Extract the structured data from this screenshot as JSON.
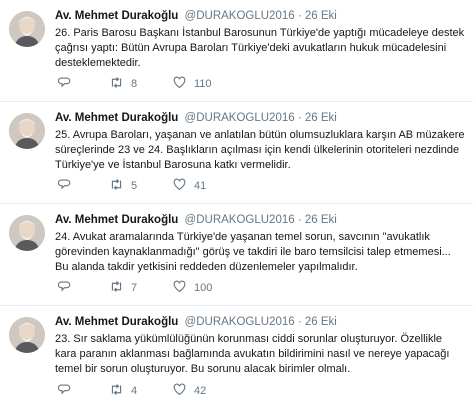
{
  "tweets": [
    {
      "name": "Av. Mehmet Durakoğlu",
      "handle": "@DURAKOGLU2016",
      "separator": "·",
      "date": "26 Eki",
      "text": "26.  Paris Barosu Başkanı İstanbul Barosunun Türkiye'de yaptığı mücadeleye destek çağrısı yaptı: Bütün Avrupa Baroları Türkiye'deki avukatların hukuk mücadelesini desteklemektedir.",
      "replies": "",
      "retweets": "8",
      "likes": "110"
    },
    {
      "name": "Av. Mehmet Durakoğlu",
      "handle": "@DURAKOGLU2016",
      "separator": "·",
      "date": "26 Eki",
      "text": "25. Avrupa Baroları, yaşanan ve anlatılan bütün olumsuzluklara karşın AB müzakere süreçlerinde 23 ve 24. Başlıkların açılması için kendi ülkelerinin otoriteleri nezdinde Türkiye'ye ve İstanbul Barosuna katkı vermelidir.",
      "replies": "",
      "retweets": "5",
      "likes": "41"
    },
    {
      "name": "Av. Mehmet Durakoğlu",
      "handle": "@DURAKOGLU2016",
      "separator": "·",
      "date": "26 Eki",
      "text": "24. Avukat aramalarında Türkiye'de yaşanan temel sorun, savcının \"avukatlık görevinden kaynaklanmadığı\" görüş ve takdiri ile baro temsilcisi talep etmemesi... Bu alanda takdir yetkisini reddeden düzenlemeler yapılmalıdır.",
      "replies": "",
      "retweets": "7",
      "likes": "100"
    },
    {
      "name": "Av. Mehmet Durakoğlu",
      "handle": "@DURAKOGLU2016",
      "separator": "·",
      "date": "26 Eki",
      "text": "23. Sır saklama yükümlülüğünün korunması ciddi sorunlar oluşturuyor. Özellikle kara paranın aklanması bağlamında avukatın bildirimini nasıl ve nereye yapacağı temel bir sorun oluşturuyor. Bu sorunu alacak birimler olmalı.",
      "replies": "",
      "retweets": "4",
      "likes": "42"
    }
  ],
  "icons": {
    "reply": "reply-icon",
    "retweet": "retweet-icon",
    "like": "heart-icon"
  },
  "colors": {
    "text": "#14171a",
    "meta": "#657786",
    "divider": "#e6ecf0"
  }
}
